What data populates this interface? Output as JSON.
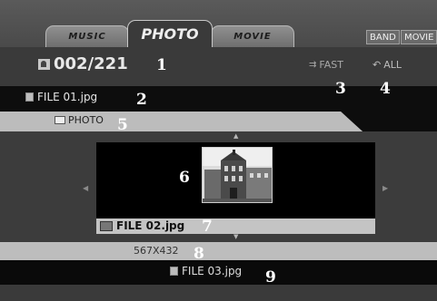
{
  "tabs": [
    {
      "label": "MUSIC"
    },
    {
      "label": "PHOTO",
      "active": true
    },
    {
      "label": "MOVIE"
    }
  ],
  "modes": {
    "band": "BAND",
    "movie": "MOVIE"
  },
  "counter": {
    "current": "002",
    "total": "221",
    "text": "002/221",
    "icon": "photo-counter-icon"
  },
  "playback": {
    "speed": "FAST",
    "speed_icon": "fast-icon",
    "repeat": "ALL",
    "repeat_icon": "repeat-icon"
  },
  "files": {
    "previous": "FILE 01.jpg",
    "current": "FILE 02.jpg",
    "next": "FILE 03.jpg"
  },
  "folder": {
    "name": "PHOTO",
    "icon": "folder-icon"
  },
  "image": {
    "resolution": "567X432",
    "thumbnail_icon": "building-photo"
  },
  "callouts": [
    "1",
    "2",
    "3",
    "4",
    "5",
    "6",
    "7",
    "8",
    "9"
  ],
  "colors": {
    "background": "#3a3a3a",
    "dark_bar": "#0d0d0d",
    "light_band": "#bcbcbc"
  }
}
